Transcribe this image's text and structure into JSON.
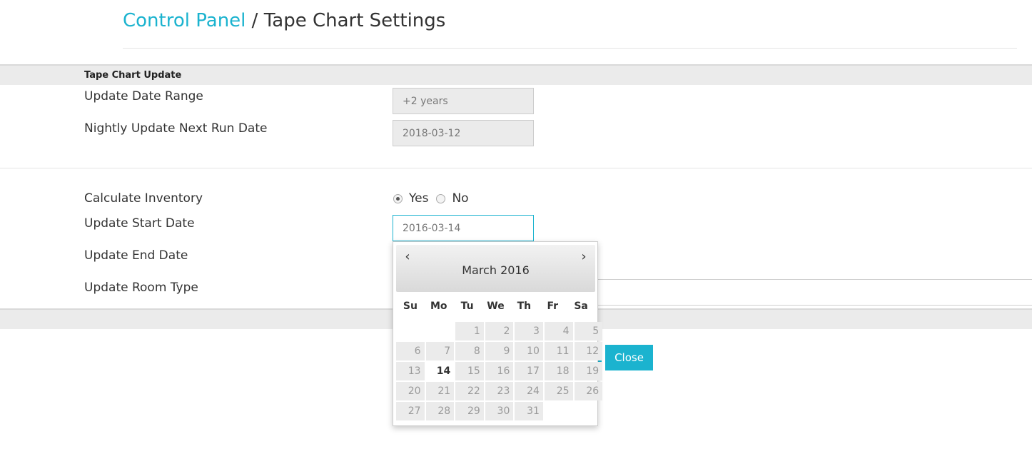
{
  "breadcrumb": {
    "link": "Control Panel",
    "separator": " / ",
    "current": "Tape Chart Settings"
  },
  "section1": {
    "title": "Tape Chart Update",
    "fields": {
      "date_range_label": "Update Date Range",
      "date_range_value": "+2 years",
      "next_run_label": "Nightly Update Next Run Date",
      "next_run_value": "2018-03-12"
    }
  },
  "section2": {
    "calc_inventory_label": "Calculate Inventory",
    "radio_yes": "Yes",
    "radio_no": "No",
    "calc_inventory_selected": "Yes",
    "start_date_label": "Update Start Date",
    "start_date_value": "2016-03-14",
    "end_date_label": "Update End Date",
    "room_type_label": "Update Room Type"
  },
  "buttons": {
    "close": "Close"
  },
  "datepicker": {
    "prev": "‹",
    "next": "›",
    "title": "March 2016",
    "weekdays": [
      "Su",
      "Mo",
      "Tu",
      "We",
      "Th",
      "Fr",
      "Sa"
    ],
    "leading_blanks": 2,
    "days": [
      "1",
      "2",
      "3",
      "4",
      "5",
      "6",
      "7",
      "8",
      "9",
      "10",
      "11",
      "12",
      "13",
      "14",
      "15",
      "16",
      "17",
      "18",
      "19",
      "20",
      "21",
      "22",
      "23",
      "24",
      "25",
      "26",
      "27",
      "28",
      "29",
      "30",
      "31"
    ],
    "today": "14"
  },
  "colors": {
    "accent": "#1bb3cf",
    "section_bar": "#ebebeb"
  }
}
